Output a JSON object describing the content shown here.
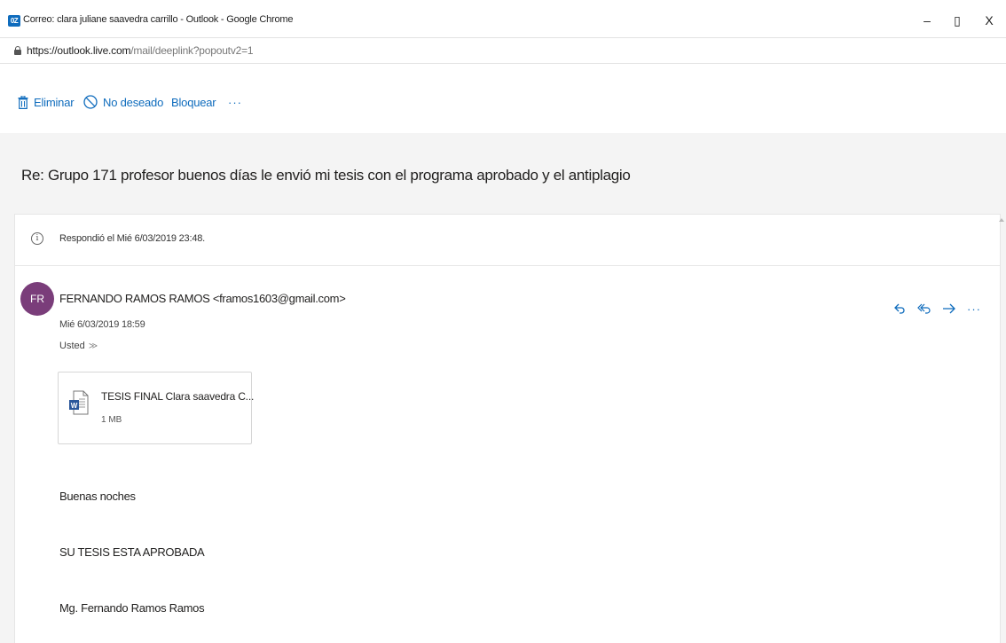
{
  "window": {
    "app_badge": "0Z",
    "title": "Correo: clara juliane saavedra carrillo - Outlook - Google Chrome",
    "minimize": "–",
    "restore": "▯",
    "close": "X"
  },
  "address": {
    "url_host": "https://outlook.live.com",
    "url_path": "/mail/deeplink?popoutv2=1"
  },
  "toolbar": {
    "delete_label": "Eliminar",
    "junk_label": "No deseado",
    "block_label": "Bloquear",
    "more_label": "···"
  },
  "message": {
    "subject": "Re: Grupo 171 profesor buenos días le envió mi tesis con el programa aprobado y el antiplagio",
    "info": "Respondió el Mié 6/03/2019 23:48.",
    "avatar_initials": "FR",
    "avatar_color": "#7a3d7a",
    "sender": "FERNANDO RAMOS RAMOS <framos1603@gmail.com>",
    "date": "Mié 6/03/2019 18:59",
    "to": "Usted",
    "more_actions": "···",
    "attachment": {
      "name": "TESIS FINAL Clara saavedra C...",
      "size": "1 MB",
      "icon": "word-file-icon"
    },
    "body": [
      "Buenas noches",
      "SU TESIS ESTA APROBADA",
      "Mg. Fernando Ramos Ramos"
    ]
  },
  "colors": {
    "accent": "#0f6cbd",
    "background": "#f4f4f4",
    "card": "#ffffff"
  }
}
